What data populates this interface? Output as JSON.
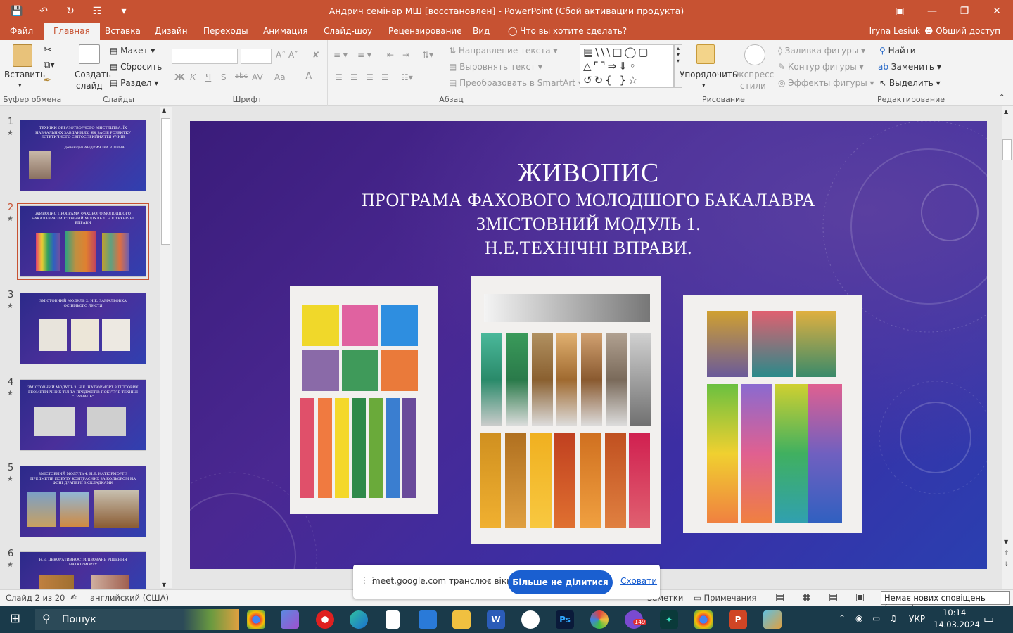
{
  "window": {
    "title": "Андрич семінар МШ [восстановлен] - PowerPoint (Сбой активации продукта)"
  },
  "tabs": [
    "Файл",
    "Главная",
    "Вставка",
    "Дизайн",
    "Переходы",
    "Анимация",
    "Слайд-шоу",
    "Рецензирование",
    "Вид"
  ],
  "active_tab": "Главная",
  "tell_me": "Что вы хотите сделать?",
  "user": "Iryna Lesiuk",
  "share": "Общий доступ",
  "ribbon": {
    "clipboard": {
      "paste": "Вставить",
      "label": "Буфер обмена"
    },
    "slides": {
      "new_slide_1": "Создать",
      "new_slide_2": "слайд",
      "layout": "Макет",
      "reset": "Сбросить",
      "section": "Раздел",
      "label": "Слайды"
    },
    "font": {
      "label": "Шрифт",
      "bold": "Ж",
      "italic": "К",
      "underline": "Ч",
      "shadow": "S",
      "strike": "abc",
      "spacing": "AV",
      "case": "Aa",
      "color": "A"
    },
    "paragraph": {
      "label": "Абзац",
      "text_dir": "Направление текста",
      "align_text": "Выровнять текст",
      "smartart": "Преобразовать в SmartArt"
    },
    "drawing": {
      "label": "Рисование",
      "arrange": "Упорядочить",
      "quick_styles_1": "Экспресс-",
      "quick_styles_2": "стили",
      "fill": "Заливка фигуры",
      "outline": "Контур фигуры",
      "effects": "Эффекты фигуры"
    },
    "editing": {
      "label": "Редактирование",
      "find": "Найти",
      "replace": "Заменить",
      "select": "Выделить"
    }
  },
  "thumbnails": [
    {
      "num": "1",
      "text": "ТЕХНІКИ ОБРАЗОТВОРЧОГО МИСТЕЦТВА, ЇХ НАВЧАЛЬНИХ ЗАВДАННЯХ, ЯК ЗАСІБ РОЗВИТКУ ЕСТЕТИЧНОГО СВІТОСПРИЙНЯТТЯ УЧНІВ",
      "sub": "Доповідач АНДРИЧ ІРА ЗЛІВНА"
    },
    {
      "num": "2",
      "text": "ЖИВОПИС ПРОГРАМА ФАХОВОГО МОЛОДШОГО БАКАЛАВРА ЗМІСТОВНИЙ МОДУЛЬ 1. Н.Е.ТЕХНІЧНІ ВПРАВИ"
    },
    {
      "num": "3",
      "text": "ЗМІСТОВНИЙ МОДУЛЬ 2. Н.Е. ЗАМАЛЬОВКА ОСІННЬОГО ЛИСТЯ"
    },
    {
      "num": "4",
      "text": "ЗМІСТОВНИЙ МОДУЛЬ 3. Н.Е. НАТЮРМОРТ З ГІПСОВИХ ГЕОМЕТРИЧНИХ ТІЛ ТА ПРЕДМЕТІВ ПОБУТУ В ТЕХНІЦІ \"ГРИЗАЛЬ\""
    },
    {
      "num": "5",
      "text": "ЗМІСТОВНИЙ МОДУЛЬ 4. Н.Е. НАТЮРМОРТ З ПРЕДМЕТІВ ПОБУТУ КОНТРАСНИХ ЗА КОЛЬОРОМ НА ФОНІ ДРАПЕРІЇ З СКЛАДКАМИ"
    },
    {
      "num": "6",
      "text": "Н.Е. ДЕКОРАТИВНОСТИЛІЗОВАНЕ РІШЕННЯ НАТЮРМОРТУ"
    }
  ],
  "slide": {
    "title": "ЖИВОПИС",
    "line1": "ПРОГРАМА ФАХОВОГО МОЛОДШОГО БАКАЛАВРА",
    "line2": "ЗМІСТОВНИЙ МОДУЛЬ 1.",
    "line3": "Н.Е.ТЕХНІЧНІ ВПРАВИ."
  },
  "share_bar": {
    "text": "meet.google.com транслює вікно.",
    "stop": "Більше не ділитися",
    "hide": "Сховати"
  },
  "status": {
    "slide": "Слайд 2 из 20",
    "lang": "английский (США)",
    "notes": "Заметки",
    "comments": "Примечания"
  },
  "toast": "Немає нових сповіщень (вимк.)",
  "taskbar": {
    "search": "Пошук",
    "lang": "УКР",
    "time": "10:14",
    "date": "14.03.2024",
    "badge": "149"
  }
}
